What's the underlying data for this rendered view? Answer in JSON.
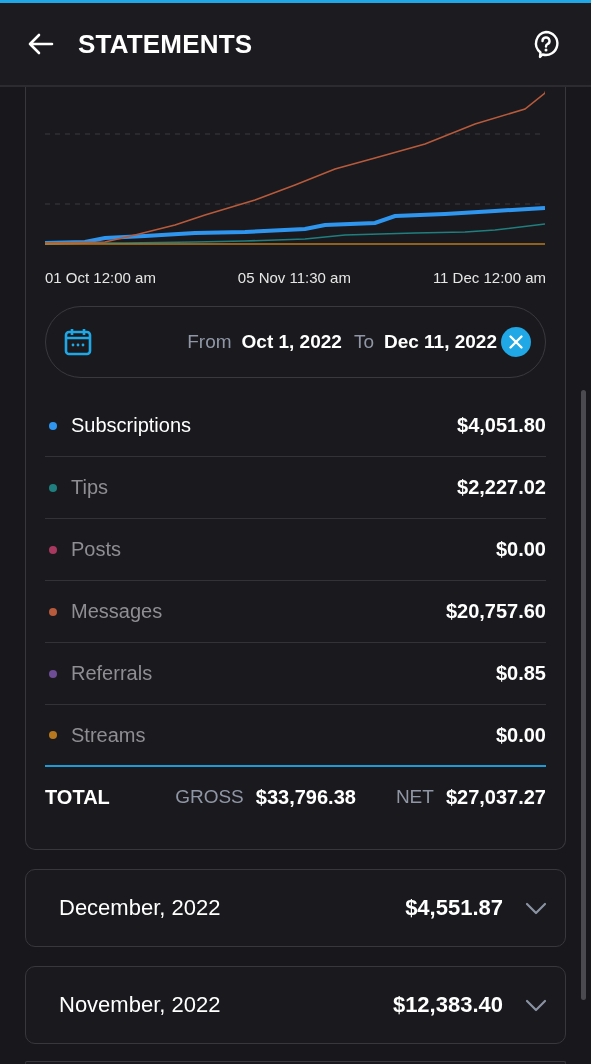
{
  "header": {
    "title": "STATEMENTS"
  },
  "chart": {
    "x_labels": [
      "01 Oct 12:00 am",
      "05 Nov 11:30 am",
      "11 Dec 12:00 am"
    ]
  },
  "date_range": {
    "from_label": "From",
    "from": "Oct 1, 2022",
    "to_label": "To",
    "to": "Dec 11, 2022"
  },
  "categories": [
    {
      "name": "Subscriptions",
      "amount": "$4,051.80",
      "color": "#2f96f0",
      "selected": true
    },
    {
      "name": "Tips",
      "amount": "$2,227.02",
      "color": "#1f7f80",
      "selected": false
    },
    {
      "name": "Posts",
      "amount": "$0.00",
      "color": "#a8385f",
      "selected": false
    },
    {
      "name": "Messages",
      "amount": "$20,757.60",
      "color": "#b85a3c",
      "selected": false
    },
    {
      "name": "Referrals",
      "amount": "$0.85",
      "color": "#6e4c96",
      "selected": false
    },
    {
      "name": "Streams",
      "amount": "$0.00",
      "color": "#b8781e",
      "selected": false
    }
  ],
  "total": {
    "label": "TOTAL",
    "gross_label": "GROSS",
    "gross": "$33,796.38",
    "net_label": "NET",
    "net": "$27,037.27"
  },
  "months": [
    {
      "name": "December, 2022",
      "amount": "$4,551.87",
      "expanded": false
    },
    {
      "name": "November, 2022",
      "amount": "$12,383.40",
      "expanded": false
    }
  ]
}
